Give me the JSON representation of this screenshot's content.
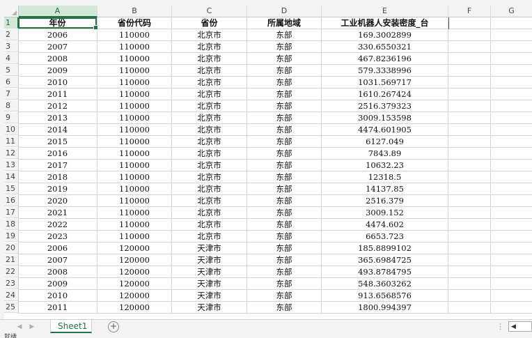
{
  "columns": [
    "A",
    "B",
    "C",
    "D",
    "E",
    "F",
    "G"
  ],
  "header_row": {
    "row_number": "1",
    "cells": [
      "年份",
      "省份代码",
      "省份",
      "所属地域",
      "工业机器人安装密度_台",
      "",
      ""
    ]
  },
  "rows": [
    {
      "n": "2",
      "cells": [
        "2006",
        "110000",
        "北京市",
        "东部",
        "169.3002899"
      ]
    },
    {
      "n": "3",
      "cells": [
        "2007",
        "110000",
        "北京市",
        "东部",
        "330.6550321"
      ]
    },
    {
      "n": "4",
      "cells": [
        "2008",
        "110000",
        "北京市",
        "东部",
        "467.8236196"
      ]
    },
    {
      "n": "5",
      "cells": [
        "2009",
        "110000",
        "北京市",
        "东部",
        "579.3338996"
      ]
    },
    {
      "n": "6",
      "cells": [
        "2010",
        "110000",
        "北京市",
        "东部",
        "1031.569717"
      ]
    },
    {
      "n": "7",
      "cells": [
        "2011",
        "110000",
        "北京市",
        "东部",
        "1610.267424"
      ]
    },
    {
      "n": "8",
      "cells": [
        "2012",
        "110000",
        "北京市",
        "东部",
        "2516.379323"
      ]
    },
    {
      "n": "9",
      "cells": [
        "2013",
        "110000",
        "北京市",
        "东部",
        "3009.153598"
      ]
    },
    {
      "n": "10",
      "cells": [
        "2014",
        "110000",
        "北京市",
        "东部",
        "4474.601905"
      ]
    },
    {
      "n": "11",
      "cells": [
        "2015",
        "110000",
        "北京市",
        "东部",
        "6127.049"
      ]
    },
    {
      "n": "12",
      "cells": [
        "2016",
        "110000",
        "北京市",
        "东部",
        "7843.89"
      ]
    },
    {
      "n": "13",
      "cells": [
        "2017",
        "110000",
        "北京市",
        "东部",
        "10632.23"
      ]
    },
    {
      "n": "14",
      "cells": [
        "2018",
        "110000",
        "北京市",
        "东部",
        "12318.5"
      ]
    },
    {
      "n": "15",
      "cells": [
        "2019",
        "110000",
        "北京市",
        "东部",
        "14137.85"
      ]
    },
    {
      "n": "16",
      "cells": [
        "2020",
        "110000",
        "北京市",
        "东部",
        "2516.379"
      ]
    },
    {
      "n": "17",
      "cells": [
        "2021",
        "110000",
        "北京市",
        "东部",
        "3009.152"
      ]
    },
    {
      "n": "18",
      "cells": [
        "2022",
        "110000",
        "北京市",
        "东部",
        "4474.602"
      ]
    },
    {
      "n": "19",
      "cells": [
        "2023",
        "110000",
        "北京市",
        "东部",
        "6653.723"
      ]
    },
    {
      "n": "20",
      "cells": [
        "2006",
        "120000",
        "天津市",
        "东部",
        "185.8899102"
      ]
    },
    {
      "n": "21",
      "cells": [
        "2007",
        "120000",
        "天津市",
        "东部",
        "365.6984725"
      ]
    },
    {
      "n": "22",
      "cells": [
        "2008",
        "120000",
        "天津市",
        "东部",
        "493.8784795"
      ]
    },
    {
      "n": "23",
      "cells": [
        "2009",
        "120000",
        "天津市",
        "东部",
        "548.3603262"
      ]
    },
    {
      "n": "24",
      "cells": [
        "2010",
        "120000",
        "天津市",
        "东部",
        "913.6568576"
      ]
    },
    {
      "n": "25",
      "cells": [
        "2011",
        "120000",
        "天津市",
        "东部",
        "1800.994397"
      ]
    }
  ],
  "selection": {
    "column": "A",
    "row": "1"
  },
  "sheet_tab": {
    "label": "Sheet1"
  },
  "add_sheet": {
    "label": "+",
    "icon": "plus-circle-icon"
  },
  "tab_nav": {
    "prev": "◀",
    "next": "▶"
  },
  "tab_more": {
    "label": "⋮"
  },
  "hscroll": {
    "left": "◀"
  },
  "status": {
    "text": "就绪"
  },
  "colors": {
    "accent": "#217346",
    "selected_header_bg": "#d2e7d7"
  }
}
